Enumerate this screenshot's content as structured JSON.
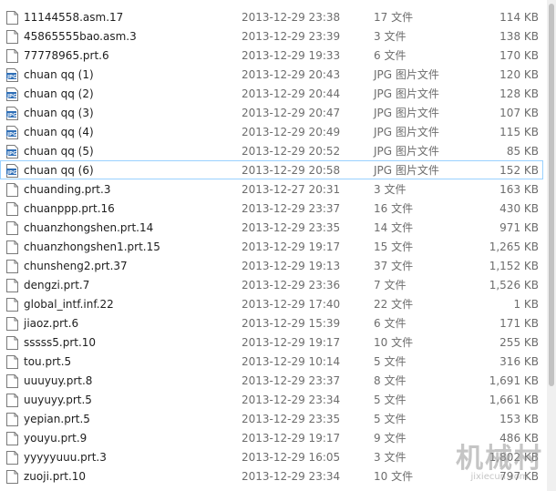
{
  "files": [
    {
      "name": "11144558.asm.17",
      "date": "2013-12-29 23:38",
      "type": "17 文件",
      "size": "114 KB",
      "icon": "generic-file-icon"
    },
    {
      "name": "45865555bao.asm.3",
      "date": "2013-12-29 23:39",
      "type": "3 文件",
      "size": "138 KB",
      "icon": "generic-file-icon"
    },
    {
      "name": "77778965.prt.6",
      "date": "2013-12-29 19:33",
      "type": "6 文件",
      "size": "170 KB",
      "icon": "generic-file-icon"
    },
    {
      "name": "chuan qq (1)",
      "date": "2013-12-29 20:43",
      "type": "JPG 图片文件",
      "size": "120 KB",
      "icon": "jpg-file-icon"
    },
    {
      "name": "chuan qq (2)",
      "date": "2013-12-29 20:44",
      "type": "JPG 图片文件",
      "size": "128 KB",
      "icon": "jpg-file-icon"
    },
    {
      "name": "chuan qq (3)",
      "date": "2013-12-29 20:47",
      "type": "JPG 图片文件",
      "size": "107 KB",
      "icon": "jpg-file-icon"
    },
    {
      "name": "chuan qq (4)",
      "date": "2013-12-29 20:49",
      "type": "JPG 图片文件",
      "size": "115 KB",
      "icon": "jpg-file-icon"
    },
    {
      "name": "chuan qq (5)",
      "date": "2013-12-29 20:52",
      "type": "JPG 图片文件",
      "size": "85 KB",
      "icon": "jpg-file-icon"
    },
    {
      "name": "chuan qq (6)",
      "date": "2013-12-29 20:58",
      "type": "JPG 图片文件",
      "size": "152 KB",
      "icon": "jpg-file-icon",
      "selected": true
    },
    {
      "name": "chuanding.prt.3",
      "date": "2013-12-27 20:31",
      "type": "3 文件",
      "size": "163 KB",
      "icon": "generic-file-icon"
    },
    {
      "name": "chuanppp.prt.16",
      "date": "2013-12-29 23:37",
      "type": "16 文件",
      "size": "430 KB",
      "icon": "generic-file-icon"
    },
    {
      "name": "chuanzhongshen.prt.14",
      "date": "2013-12-29 23:35",
      "type": "14 文件",
      "size": "971 KB",
      "icon": "generic-file-icon"
    },
    {
      "name": "chuanzhongshen1.prt.15",
      "date": "2013-12-29 19:17",
      "type": "15 文件",
      "size": "1,265 KB",
      "icon": "generic-file-icon"
    },
    {
      "name": "chunsheng2.prt.37",
      "date": "2013-12-29 19:13",
      "type": "37 文件",
      "size": "1,152 KB",
      "icon": "generic-file-icon"
    },
    {
      "name": "dengzi.prt.7",
      "date": "2013-12-29 23:36",
      "type": "7 文件",
      "size": "1,526 KB",
      "icon": "generic-file-icon"
    },
    {
      "name": "global_intf.inf.22",
      "date": "2013-12-29 17:40",
      "type": "22 文件",
      "size": "1 KB",
      "icon": "generic-file-icon"
    },
    {
      "name": "jiaoz.prt.6",
      "date": "2013-12-29 15:39",
      "type": "6 文件",
      "size": "171 KB",
      "icon": "generic-file-icon"
    },
    {
      "name": "sssss5.prt.10",
      "date": "2013-12-29 19:17",
      "type": "10 文件",
      "size": "255 KB",
      "icon": "generic-file-icon"
    },
    {
      "name": "tou.prt.5",
      "date": "2013-12-29 10:14",
      "type": "5 文件",
      "size": "316 KB",
      "icon": "generic-file-icon"
    },
    {
      "name": "uuuyuy.prt.8",
      "date": "2013-12-29 23:37",
      "type": "8 文件",
      "size": "1,691 KB",
      "icon": "generic-file-icon"
    },
    {
      "name": "uuyuyy.prt.5",
      "date": "2013-12-29 23:34",
      "type": "5 文件",
      "size": "1,661 KB",
      "icon": "generic-file-icon"
    },
    {
      "name": "yepian.prt.5",
      "date": "2013-12-29 23:35",
      "type": "5 文件",
      "size": "153 KB",
      "icon": "generic-file-icon"
    },
    {
      "name": "youyu.prt.9",
      "date": "2013-12-29 19:17",
      "type": "9 文件",
      "size": "486 KB",
      "icon": "generic-file-icon"
    },
    {
      "name": "yyyyyuuu.prt.3",
      "date": "2013-12-29 16:05",
      "type": "3 文件",
      "size": "1,802 KB",
      "icon": "generic-file-icon"
    },
    {
      "name": "zuoji.prt.10",
      "date": "2013-12-29 23:34",
      "type": "10 文件",
      "size": "797 KB",
      "icon": "generic-file-icon"
    }
  ],
  "watermark": {
    "main": "机械村",
    "sub": "jixiecun.com"
  },
  "colors": {
    "selection_border": "#99d1ff",
    "secondary_text": "#6d6d6d",
    "jpg_icon": "#2f6fb7"
  }
}
